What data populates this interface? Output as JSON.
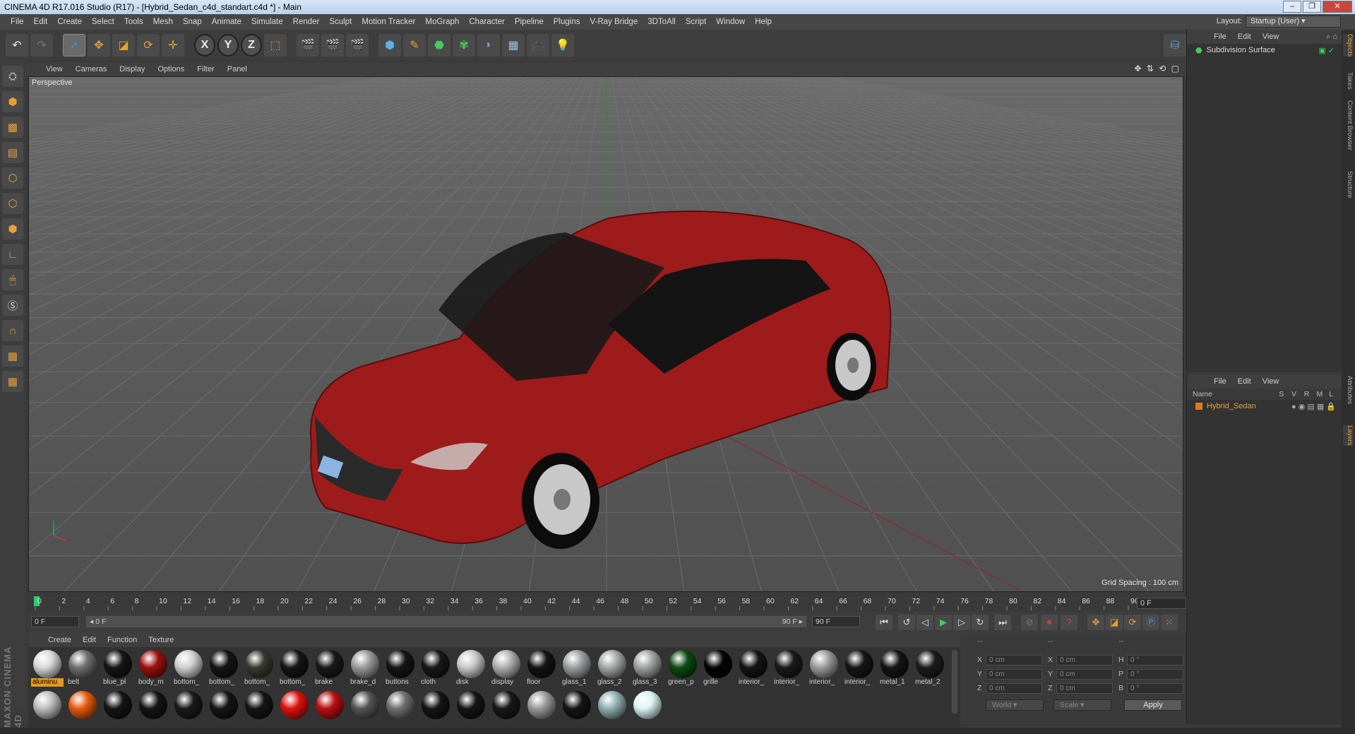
{
  "window": {
    "title": "CINEMA 4D R17.016 Studio (R17) - [Hybrid_Sedan_c4d_standart.c4d *] - Main",
    "min_glyph": "–",
    "max_glyph": "❐",
    "close_glyph": "✕"
  },
  "menubar": {
    "items": [
      "File",
      "Edit",
      "Create",
      "Select",
      "Tools",
      "Mesh",
      "Snap",
      "Animate",
      "Simulate",
      "Render",
      "Sculpt",
      "Motion Tracker",
      "MoGraph",
      "Character",
      "Pipeline",
      "Plugins",
      "V-Ray Bridge",
      "3DToAll",
      "Script",
      "Window",
      "Help"
    ],
    "layout_label": "Layout:",
    "layout_value": "Startup (User)"
  },
  "toolbar": {
    "undo_icon": "↶",
    "redo_icon": "↷",
    "x_axis_label": "X",
    "y_axis_label": "Y",
    "z_axis_label": "Z",
    "tools": [
      "select-icon",
      "move-icon",
      "scale-icon",
      "rotate-icon",
      "transform-icon"
    ]
  },
  "viewport": {
    "menu": [
      "View",
      "Cameras",
      "Display",
      "Options",
      "Filter",
      "Panel"
    ],
    "camera_label": "Perspective",
    "grid_spacing": "Grid Spacing : 100 cm",
    "nav_icons": "✥ ⇅ ⟲ ▢"
  },
  "timeline": {
    "ticks": [
      "0",
      "2",
      "4",
      "6",
      "8",
      "10",
      "12",
      "14",
      "16",
      "18",
      "20",
      "22",
      "24",
      "26",
      "28",
      "30",
      "32",
      "34",
      "36",
      "38",
      "40",
      "42",
      "44",
      "46",
      "48",
      "50",
      "52",
      "54",
      "56",
      "58",
      "60",
      "62",
      "64",
      "66",
      "68",
      "70",
      "72",
      "74",
      "76",
      "78",
      "80",
      "82",
      "84",
      "86",
      "88",
      "90"
    ],
    "current_frame_right": "0 F",
    "start_field": "0 F",
    "range_start": "◂ 0 F",
    "range_end": "90 F ▸",
    "end_field": "90 F"
  },
  "materials": {
    "menu": [
      "Create",
      "Edit",
      "Function",
      "Texture"
    ],
    "row1": [
      {
        "name": "aluminu",
        "color": "#d8d8d8",
        "selected": true
      },
      {
        "name": "belt",
        "color": "#707070"
      },
      {
        "name": "blue_pl",
        "color": "#151515"
      },
      {
        "name": "body_m",
        "color": "#9b1010"
      },
      {
        "name": "bottom_",
        "color": "#d0d0d0"
      },
      {
        "name": "bottom_",
        "color": "#151515"
      },
      {
        "name": "bottom_",
        "color": "#3a3a32"
      },
      {
        "name": "bottom_",
        "color": "#151515"
      },
      {
        "name": "brake",
        "color": "#1a1a1a"
      },
      {
        "name": "brake_d",
        "color": "#9a9a9a"
      },
      {
        "name": "buttons",
        "color": "#151515"
      },
      {
        "name": "cloth",
        "color": "#181818"
      },
      {
        "name": "disk",
        "color": "#c8c8c8"
      },
      {
        "name": "display",
        "color": "#b0b0b0"
      },
      {
        "name": "floor",
        "color": "#141414"
      },
      {
        "name": "glass_1",
        "color": "#9aa0a0"
      },
      {
        "name": "glass_2",
        "color": "#a5a8a8"
      },
      {
        "name": "glass_3",
        "color": "#a0a3a3"
      },
      {
        "name": "green_p",
        "color": "#0d4a12"
      },
      {
        "name": "grille",
        "color": "#050505"
      },
      {
        "name": "interior_",
        "color": "#141414"
      },
      {
        "name": "interior_",
        "color": "#1a1a1a"
      },
      {
        "name": "interior_",
        "color": "#9a9a9a"
      },
      {
        "name": "interior_",
        "color": "#161616"
      },
      {
        "name": "metal_1",
        "color": "#151515"
      },
      {
        "name": "metal_2",
        "color": "#1c1c1c"
      }
    ],
    "row2_colors": [
      "#bdbdbd",
      "#e85a10",
      "#151515",
      "#151515",
      "#1a1a1a",
      "#151515",
      "#151515",
      "#e01010",
      "#b81010",
      "#555555",
      "#707070",
      "#151515",
      "#151515",
      "#181818",
      "#9a9a9a",
      "#151515",
      "#8fb0b0",
      "#dcf4f4"
    ]
  },
  "coords": {
    "headers": [
      "--",
      "--",
      "--"
    ],
    "rows": [
      {
        "a": "X",
        "av": "0 cm",
        "b": "X",
        "bv": "0 cm",
        "c": "H",
        "cv": "0 °"
      },
      {
        "a": "Y",
        "av": "0 cm",
        "b": "Y",
        "bv": "0 cm",
        "c": "P",
        "cv": "0 °"
      },
      {
        "a": "Z",
        "av": "0 cm",
        "b": "Z",
        "bv": "0 cm",
        "c": "B",
        "cv": "0 °"
      }
    ],
    "space": "World",
    "mode": "Scale",
    "apply": "Apply"
  },
  "objects": {
    "menu": [
      "File",
      "Edit",
      "View"
    ],
    "items": [
      {
        "name": "Subdivision Surface"
      }
    ]
  },
  "layers": {
    "menu": [
      "File",
      "Edit",
      "View"
    ],
    "columns": [
      "Name",
      "S",
      "V",
      "R",
      "M",
      "L"
    ],
    "items": [
      {
        "name": "Hybrid_Sedan",
        "color": "#e07a1a"
      }
    ]
  },
  "side_tabs": [
    "Objects",
    "Takes",
    "Content Browser",
    "Structure",
    "Attributes",
    "Layers"
  ],
  "logo": "MAXON CINEMA 4D",
  "accent": "#e49a1c"
}
